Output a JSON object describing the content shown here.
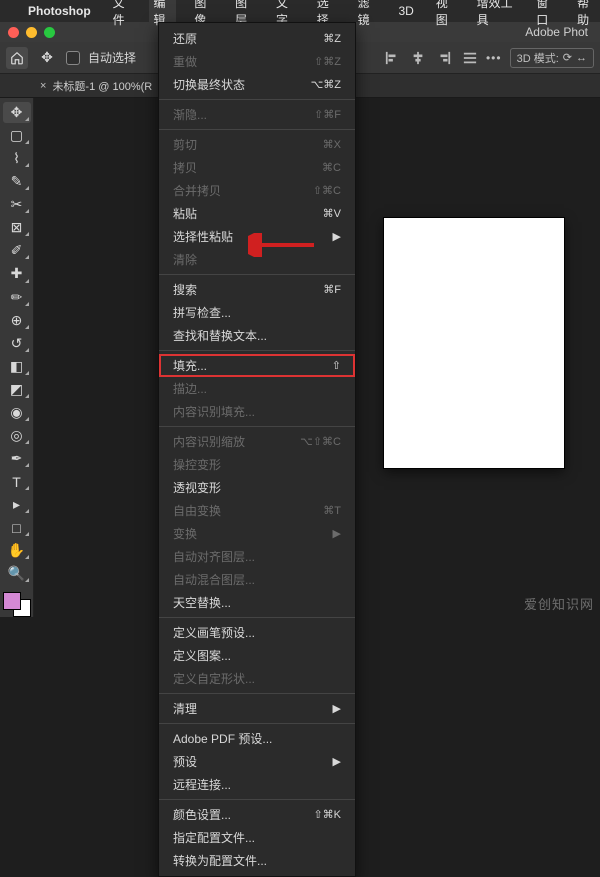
{
  "menubar": {
    "app": "Photoshop",
    "items": [
      "文件",
      "编辑",
      "图像",
      "图层",
      "文字",
      "选择",
      "滤镜",
      "3D",
      "视图",
      "增效工具",
      "窗口",
      "帮助"
    ],
    "active_index": 1
  },
  "window": {
    "title_right": "Adobe Phot"
  },
  "options": {
    "auto_select_label": "自动选择",
    "threed_label": "3D 模式:"
  },
  "doc_tab": {
    "label": "未标题-1 @ 100%(R"
  },
  "dropdown": {
    "groups": [
      [
        {
          "label": "还原",
          "shortcut": "⌘Z",
          "disabled": false
        },
        {
          "label": "重做",
          "shortcut": "⇧⌘Z",
          "disabled": true
        },
        {
          "label": "切换最终状态",
          "shortcut": "⌥⌘Z",
          "disabled": false
        }
      ],
      [
        {
          "label": "渐隐...",
          "shortcut": "⇧⌘F",
          "disabled": true
        }
      ],
      [
        {
          "label": "剪切",
          "shortcut": "⌘X",
          "disabled": true
        },
        {
          "label": "拷贝",
          "shortcut": "⌘C",
          "disabled": true
        },
        {
          "label": "合并拷贝",
          "shortcut": "⇧⌘C",
          "disabled": true
        },
        {
          "label": "粘贴",
          "shortcut": "⌘V",
          "disabled": false
        },
        {
          "label": "选择性粘贴",
          "shortcut": "▶",
          "disabled": false
        },
        {
          "label": "清除",
          "shortcut": "",
          "disabled": true
        }
      ],
      [
        {
          "label": "搜索",
          "shortcut": "⌘F",
          "disabled": false
        },
        {
          "label": "拼写检查...",
          "shortcut": "",
          "disabled": false
        },
        {
          "label": "查找和替换文本...",
          "shortcut": "",
          "disabled": false
        }
      ],
      [
        {
          "label": "填充...",
          "shortcut": "⇧",
          "disabled": false,
          "highlight": true
        },
        {
          "label": "描边...",
          "shortcut": "",
          "disabled": true
        },
        {
          "label": "内容识别填充...",
          "shortcut": "",
          "disabled": true
        }
      ],
      [
        {
          "label": "内容识别缩放",
          "shortcut": "⌥⇧⌘C",
          "disabled": true
        },
        {
          "label": "操控变形",
          "shortcut": "",
          "disabled": true
        },
        {
          "label": "透视变形",
          "shortcut": "",
          "disabled": false
        },
        {
          "label": "自由变换",
          "shortcut": "⌘T",
          "disabled": true
        },
        {
          "label": "变换",
          "shortcut": "▶",
          "disabled": true
        },
        {
          "label": "自动对齐图层...",
          "shortcut": "",
          "disabled": true
        },
        {
          "label": "自动混合图层...",
          "shortcut": "",
          "disabled": true
        },
        {
          "label": "天空替换...",
          "shortcut": "",
          "disabled": false
        }
      ],
      [
        {
          "label": "定义画笔预设...",
          "shortcut": "",
          "disabled": false
        },
        {
          "label": "定义图案...",
          "shortcut": "",
          "disabled": false
        },
        {
          "label": "定义自定形状...",
          "shortcut": "",
          "disabled": true
        }
      ],
      [
        {
          "label": "清理",
          "shortcut": "▶",
          "disabled": false
        }
      ],
      [
        {
          "label": "Adobe PDF 预设...",
          "shortcut": "",
          "disabled": false
        },
        {
          "label": "预设",
          "shortcut": "▶",
          "disabled": false
        },
        {
          "label": "远程连接...",
          "shortcut": "",
          "disabled": false
        }
      ],
      [
        {
          "label": "颜色设置...",
          "shortcut": "⇧⌘K",
          "disabled": false
        },
        {
          "label": "指定配置文件...",
          "shortcut": "",
          "disabled": false
        },
        {
          "label": "转换为配置文件...",
          "shortcut": "",
          "disabled": false
        }
      ]
    ]
  },
  "tools": [
    {
      "name": "move-tool",
      "glyph": "✥",
      "active": true
    },
    {
      "name": "marquee-tool",
      "glyph": "▢"
    },
    {
      "name": "lasso-tool",
      "glyph": "⌇"
    },
    {
      "name": "quick-select-tool",
      "glyph": "✎"
    },
    {
      "name": "crop-tool",
      "glyph": "✂"
    },
    {
      "name": "frame-tool",
      "glyph": "⊠"
    },
    {
      "name": "eyedropper-tool",
      "glyph": "✐"
    },
    {
      "name": "healing-tool",
      "glyph": "✚"
    },
    {
      "name": "brush-tool",
      "glyph": "✏"
    },
    {
      "name": "stamp-tool",
      "glyph": "⊕"
    },
    {
      "name": "history-brush-tool",
      "glyph": "↺"
    },
    {
      "name": "eraser-tool",
      "glyph": "◧"
    },
    {
      "name": "gradient-tool",
      "glyph": "◩"
    },
    {
      "name": "blur-tool",
      "glyph": "◉"
    },
    {
      "name": "dodge-tool",
      "glyph": "◎"
    },
    {
      "name": "pen-tool",
      "glyph": "✒"
    },
    {
      "name": "type-tool",
      "glyph": "T"
    },
    {
      "name": "path-select-tool",
      "glyph": "▸"
    },
    {
      "name": "shape-tool",
      "glyph": "□"
    },
    {
      "name": "hand-tool",
      "glyph": "✋"
    },
    {
      "name": "zoom-tool",
      "glyph": "🔍"
    }
  ],
  "watermark": "爱创知识网"
}
